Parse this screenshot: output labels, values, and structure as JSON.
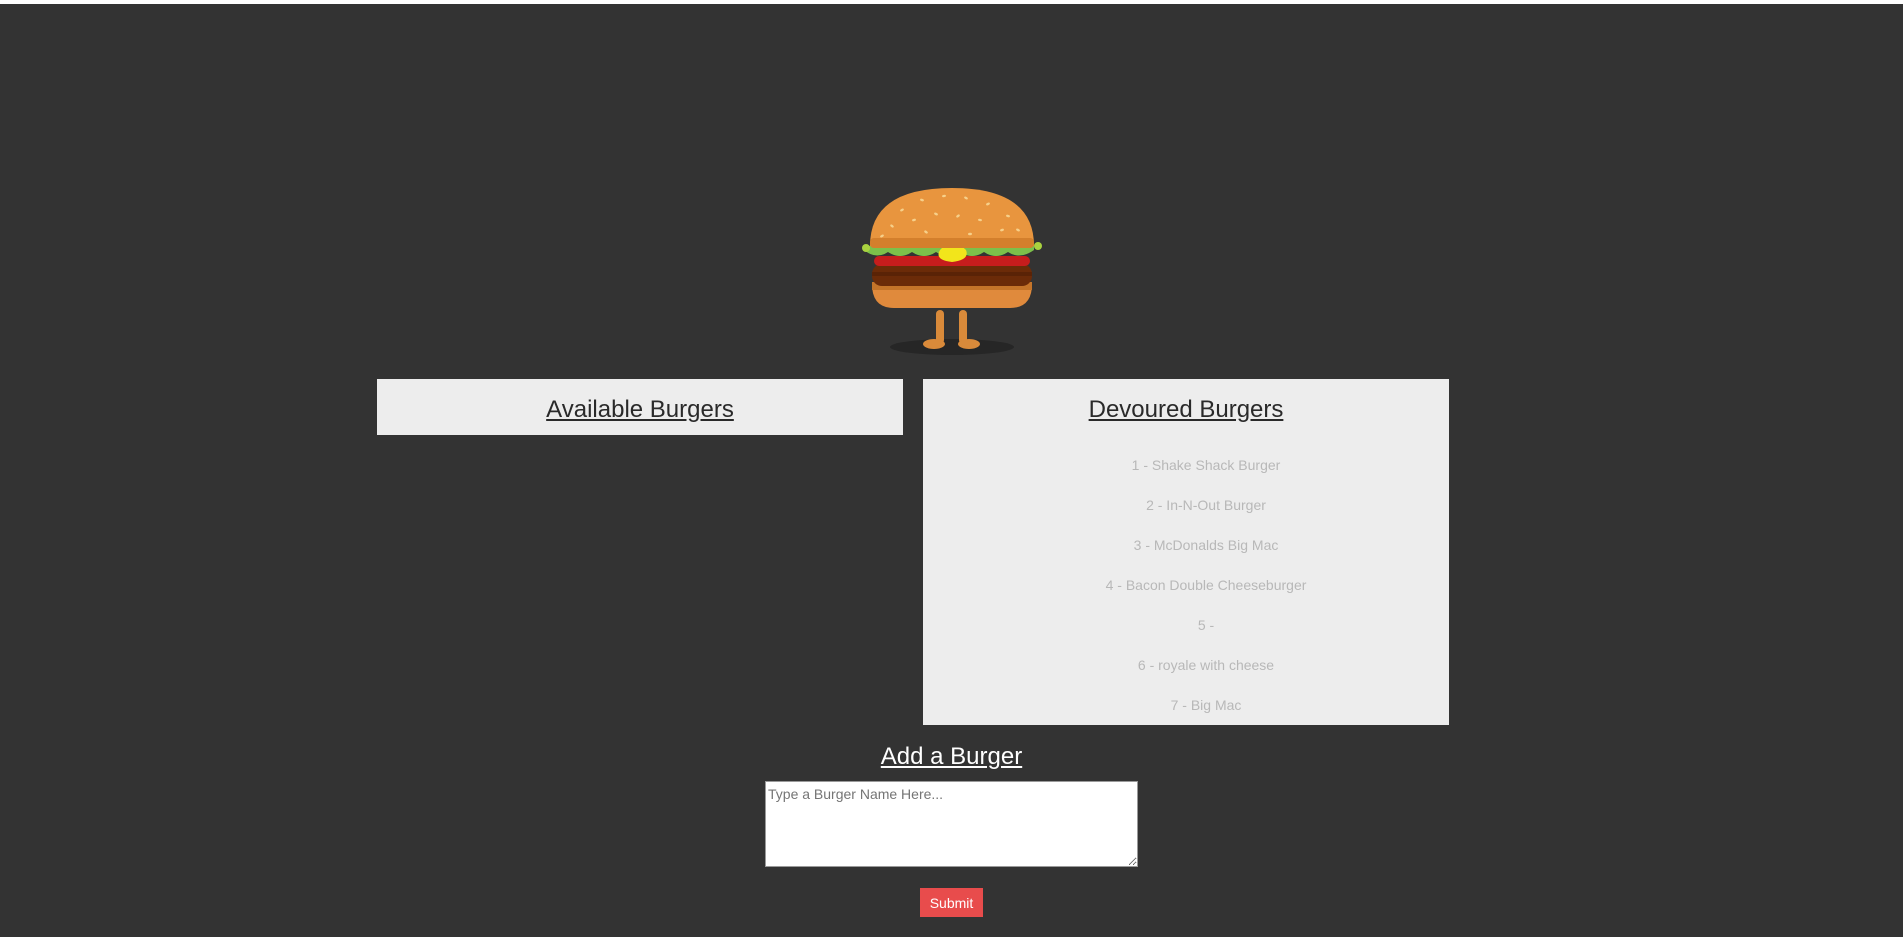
{
  "colors": {
    "background": "#333333",
    "panel": "#ededed",
    "submit_button": "#e84c4c"
  },
  "hero": {
    "icon": "burger-character-icon"
  },
  "available": {
    "title": "Available Burgers",
    "items": []
  },
  "devoured": {
    "title": "Devoured Burgers",
    "items": [
      "1 - Shake Shack Burger",
      "2 - In-N-Out Burger",
      "3 - McDonalds Big Mac",
      "4 - Bacon Double Cheeseburger",
      "5 -",
      "6 - royale with cheese",
      "7 - Big Mac"
    ]
  },
  "add_form": {
    "title": "Add a Burger",
    "placeholder": "Type a Burger Name Here...",
    "submit_label": "Submit"
  }
}
